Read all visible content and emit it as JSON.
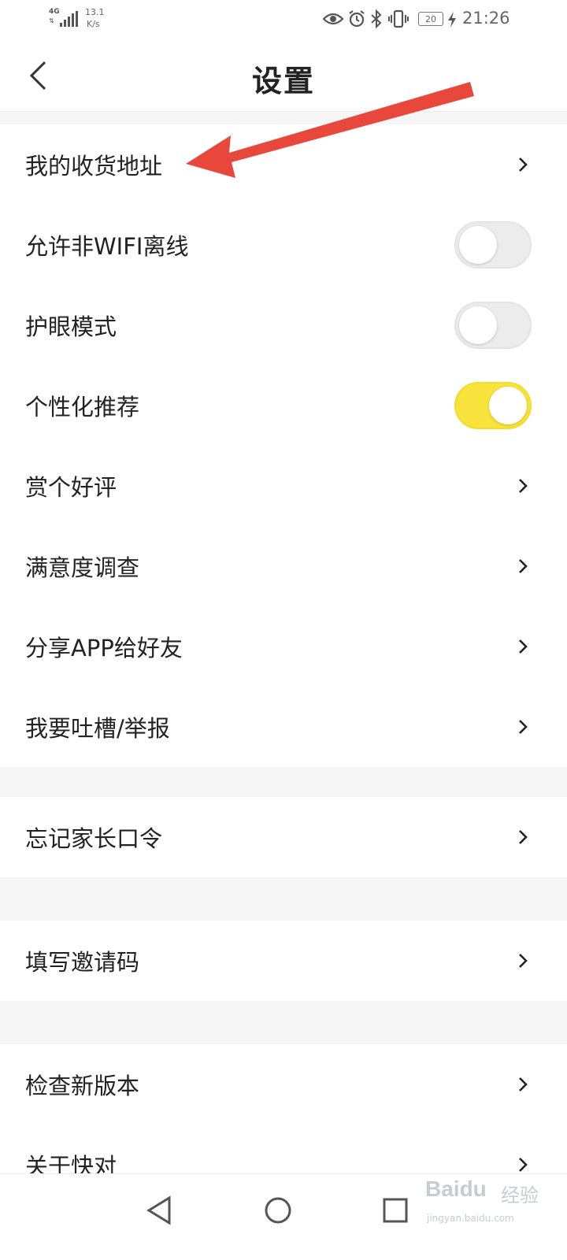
{
  "status_bar": {
    "network_type": "4G",
    "speed_value": "13.1",
    "speed_unit": "K/s",
    "battery": "20",
    "time": "21:26",
    "icons": [
      "eye-icon",
      "alarm-icon",
      "bluetooth-icon",
      "vibrate-icon",
      "battery-icon",
      "charging-icon"
    ]
  },
  "header": {
    "title": "设置",
    "back_icon": "back-chevron-icon"
  },
  "sections": [
    {
      "items": [
        {
          "label": "我的收货地址",
          "control": "chevron"
        },
        {
          "label": "允许非WIFI离线",
          "control": "toggle",
          "on": false
        },
        {
          "label": "护眼模式",
          "control": "toggle",
          "on": false
        },
        {
          "label": "个性化推荐",
          "control": "toggle",
          "on": true
        },
        {
          "label": "赏个好评",
          "control": "chevron"
        },
        {
          "label": "满意度调查",
          "control": "chevron"
        },
        {
          "label": "分享APP给好友",
          "control": "chevron"
        },
        {
          "label": "我要吐槽/举报",
          "control": "chevron"
        }
      ]
    },
    {
      "items": [
        {
          "label": "忘记家长口令",
          "control": "chevron"
        }
      ]
    },
    {
      "items": [
        {
          "label": "填写邀请码",
          "control": "chevron"
        }
      ]
    },
    {
      "items": [
        {
          "label": "检查新版本",
          "control": "chevron"
        },
        {
          "label": "关于快对",
          "control": "chevron"
        }
      ]
    }
  ],
  "colors": {
    "toggle_on": "#f7e33c",
    "toggle_off": "#ececec",
    "annotation_arrow": "#e8473b",
    "page_background": "#f6f6f6"
  },
  "nav_bar": {
    "icons": [
      "nav-back-icon",
      "nav-home-icon",
      "nav-recents-icon"
    ]
  },
  "watermark": {
    "brand": "Baidu",
    "brand_cn": "经验",
    "url": "jingyan.baidu.com"
  }
}
